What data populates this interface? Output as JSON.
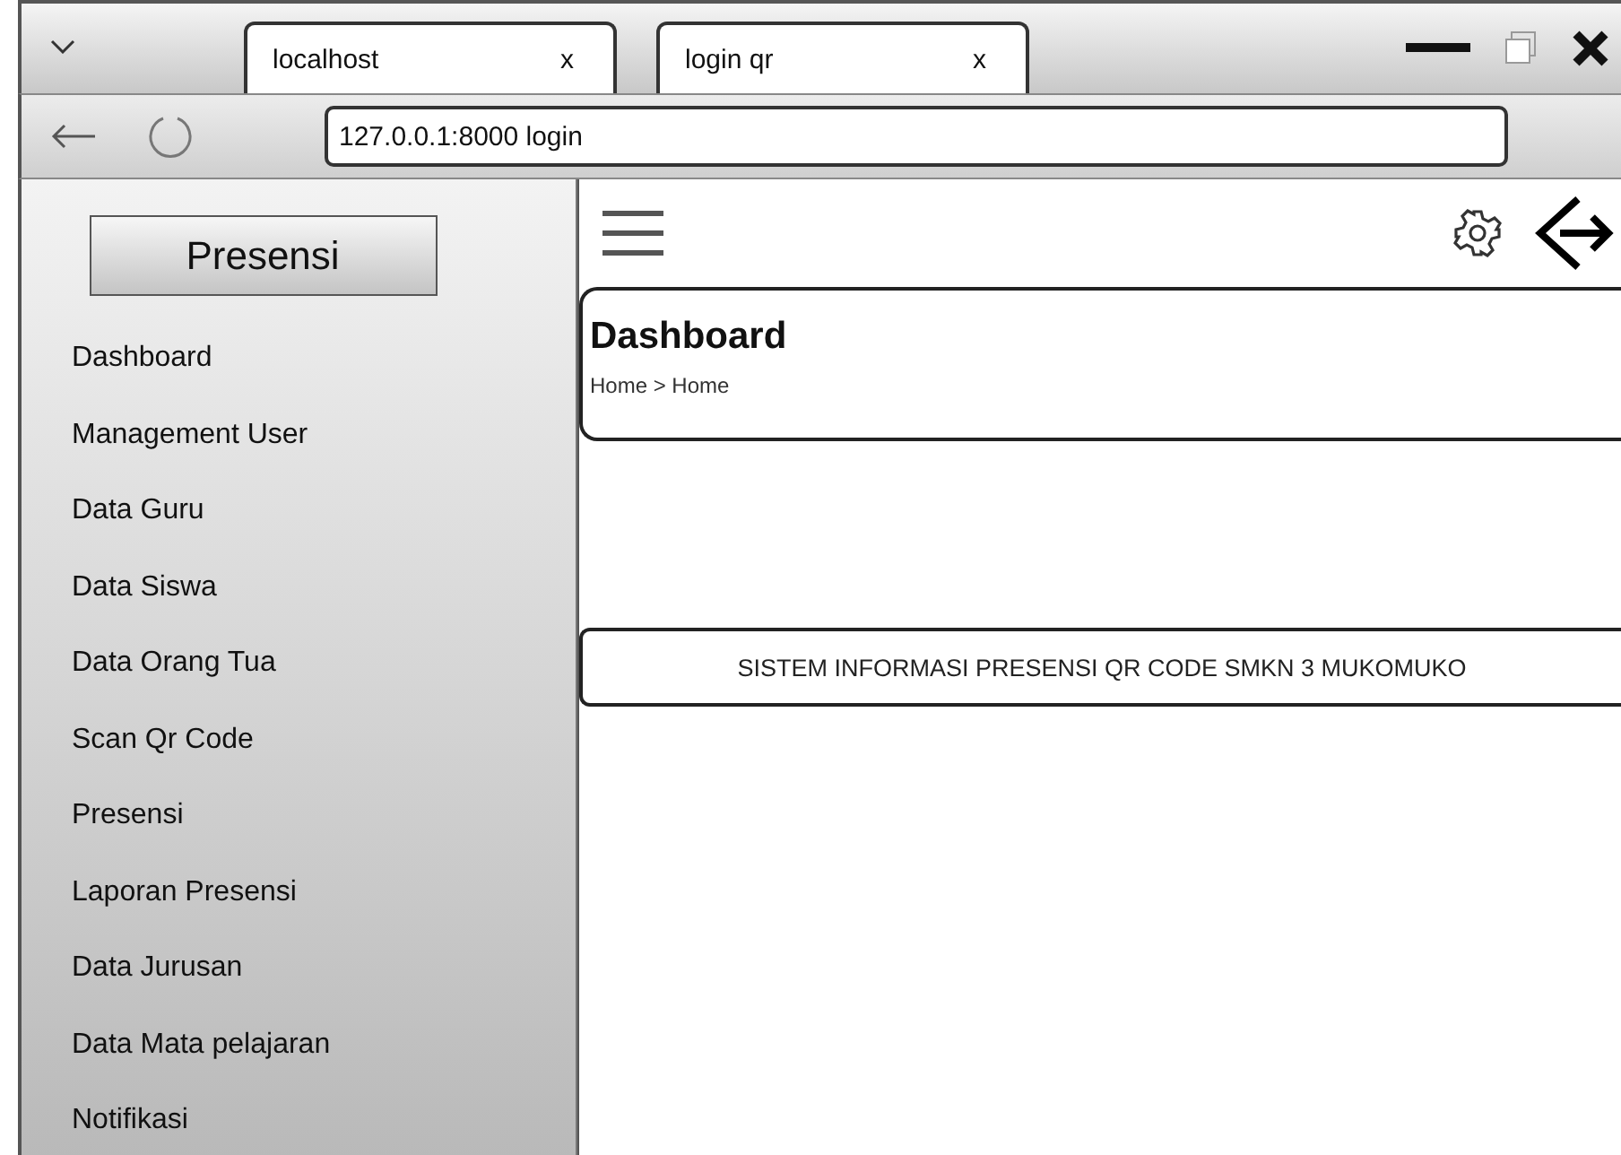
{
  "browser": {
    "tabs": [
      {
        "label": "localhost",
        "close": "x"
      },
      {
        "label": "login qr",
        "close": "x"
      }
    ],
    "address": "127.0.0.1:8000 login"
  },
  "sidebar": {
    "brand": "Presensi",
    "items": [
      "Dashboard",
      "Management User",
      "Data Guru",
      "Data Siswa",
      "Data Orang Tua",
      "Scan Qr Code",
      "Presensi",
      "Laporan Presensi",
      "Data Jurusan",
      "Data Mata pelajaran",
      "Notifikasi"
    ]
  },
  "page": {
    "title": "Dashboard",
    "breadcrumb": "Home > Home",
    "footer": "SISTEM INFORMASI PRESENSI QR CODE SMKN 3 MUKOMUKO"
  }
}
